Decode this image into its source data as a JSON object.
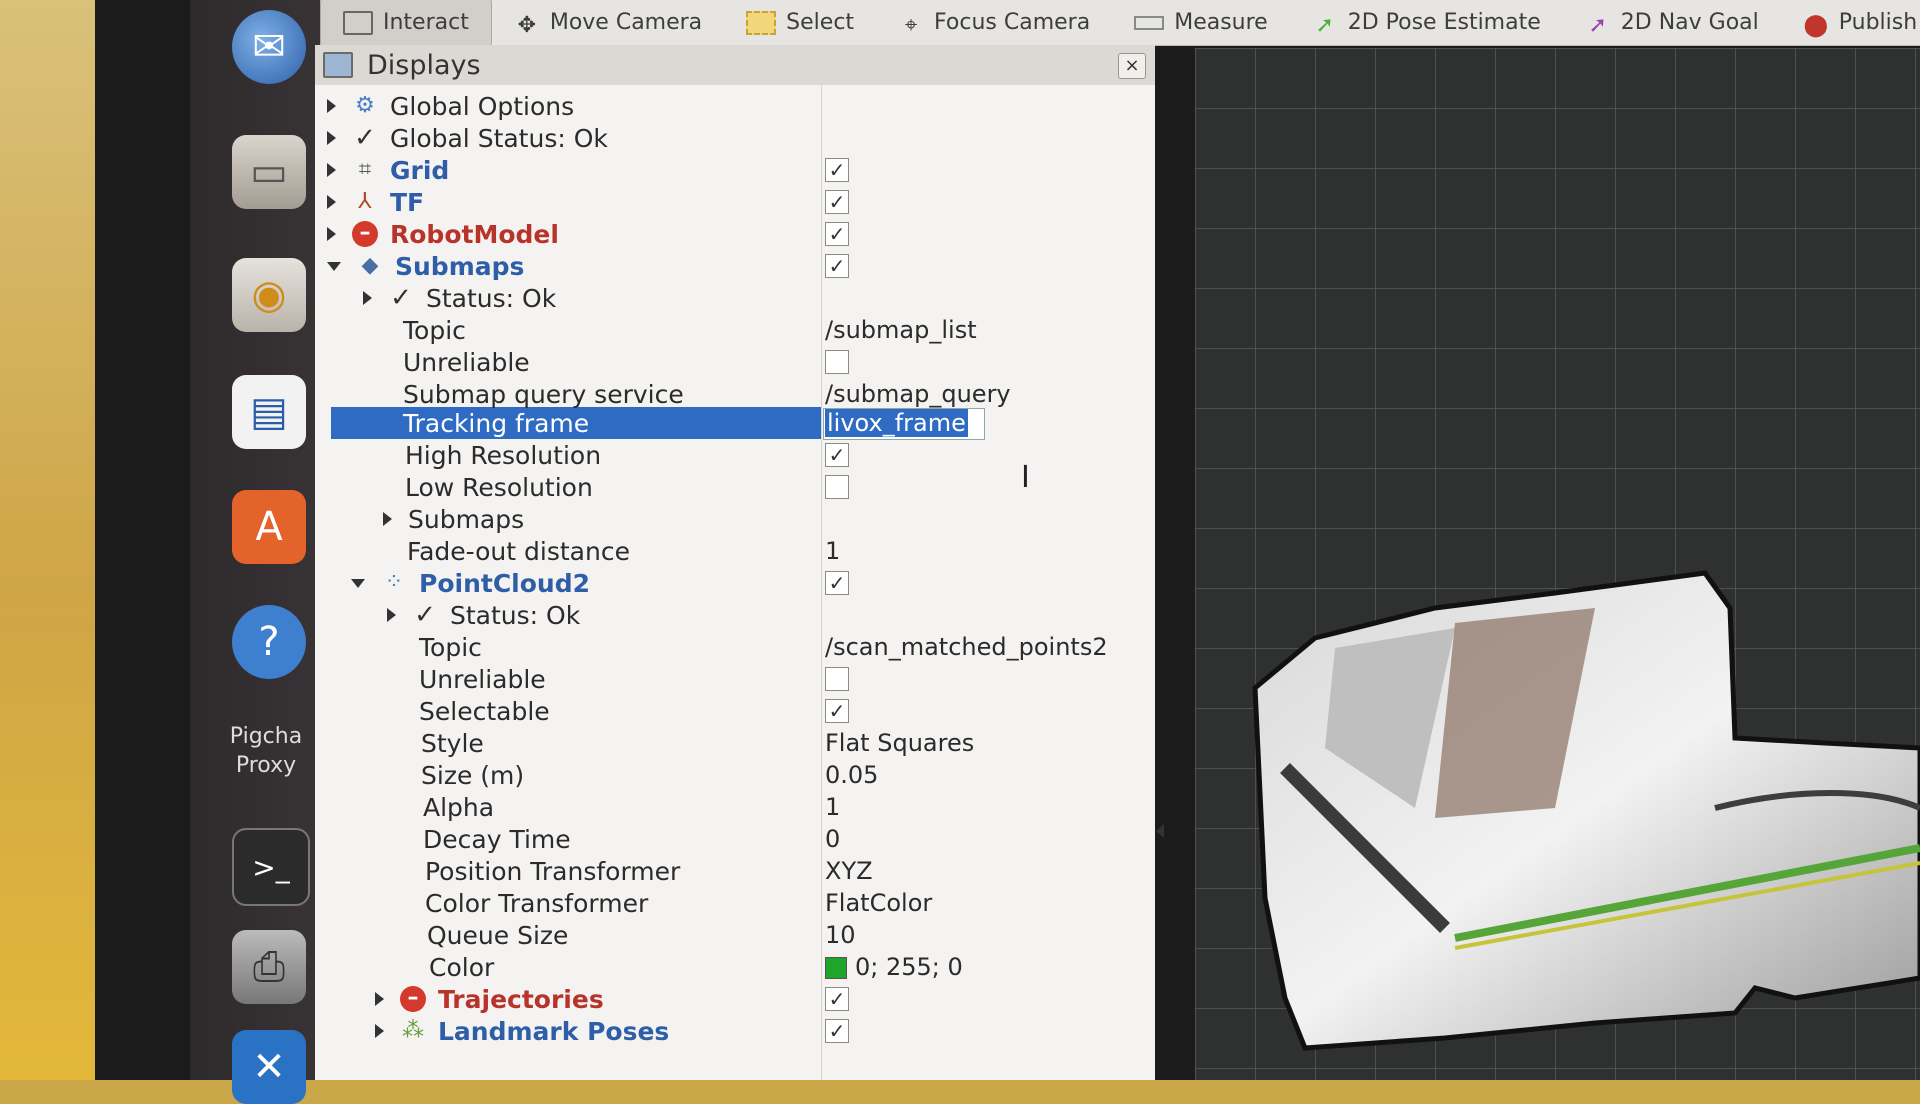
{
  "toolbar": {
    "tools": [
      {
        "label": "Interact",
        "icon": "interact-icon",
        "active": true
      },
      {
        "label": "Move Camera",
        "icon": "move-camera-icon"
      },
      {
        "label": "Select",
        "icon": "select-icon"
      },
      {
        "label": "Focus Camera",
        "icon": "focus-camera-icon"
      },
      {
        "label": "Measure",
        "icon": "measure-icon"
      },
      {
        "label": "2D Pose Estimate",
        "icon": "pose-estimate-icon"
      },
      {
        "label": "2D Nav Goal",
        "icon": "nav-goal-icon"
      },
      {
        "label": "Publish Point",
        "icon": "publish-point-icon"
      }
    ]
  },
  "launcher": {
    "proxy_label_line1": "Pigcha",
    "proxy_label_line2": "Proxy"
  },
  "panel": {
    "title": "Displays",
    "close_glyph": "×"
  },
  "tree": {
    "global_options": "Global Options",
    "global_status": "Global Status: Ok",
    "grid": "Grid",
    "tf": "TF",
    "robot_model": "RobotModel",
    "submaps": {
      "label": "Submaps",
      "status": "Status: Ok",
      "topic_label": "Topic",
      "topic_value": "/submap_list",
      "unreliable_label": "Unreliable",
      "query_service_label": "Submap query service",
      "query_service_value": "/submap_query",
      "tracking_frame_label": "Tracking frame",
      "tracking_frame_value": "livox_frame",
      "high_res_label": "High Resolution",
      "low_res_label": "Low Resolution",
      "submaps_child_label": "Submaps",
      "fade_out_label": "Fade-out distance",
      "fade_out_value": "1"
    },
    "pointcloud2": {
      "label": "PointCloud2",
      "status": "Status: Ok",
      "topic_label": "Topic",
      "topic_value": "/scan_matched_points2",
      "unreliable_label": "Unreliable",
      "selectable_label": "Selectable",
      "style_label": "Style",
      "style_value": "Flat Squares",
      "size_label": "Size (m)",
      "size_value": "0.05",
      "alpha_label": "Alpha",
      "alpha_value": "1",
      "decay_label": "Decay Time",
      "decay_value": "0",
      "position_transformer_label": "Position Transformer",
      "position_transformer_value": "XYZ",
      "color_transformer_label": "Color Transformer",
      "color_transformer_value": "FlatColor",
      "queue_label": "Queue Size",
      "queue_value": "10",
      "color_label": "Color",
      "color_value": "0; 255; 0",
      "color_hex": "#1fa52a"
    },
    "trajectories": "Trajectories",
    "landmark_poses": "Landmark Poses"
  },
  "colors": {
    "selection": "#2f6bc2",
    "display_blue": "#2f5ea8",
    "display_error": "#b8332a"
  }
}
